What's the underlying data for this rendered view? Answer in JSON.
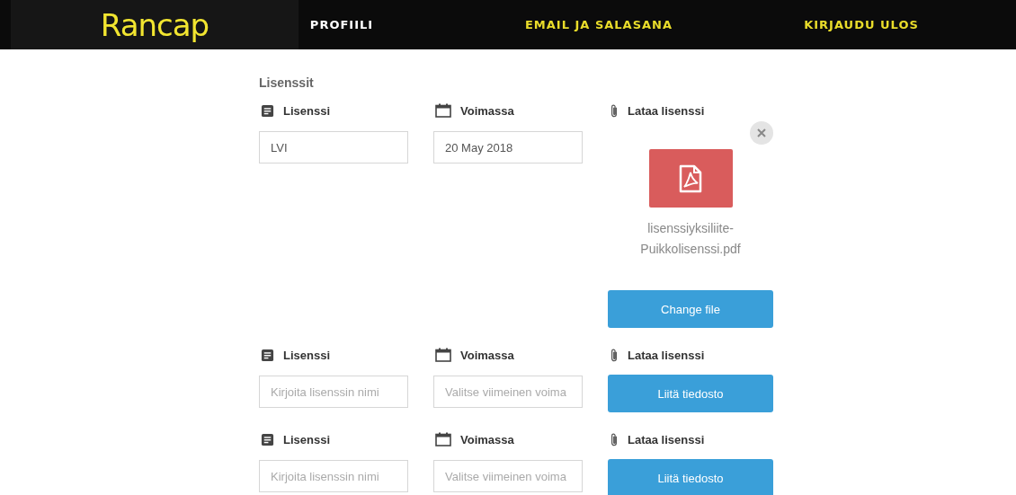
{
  "header": {
    "logo": "Rancap",
    "nav": [
      {
        "label": "PROFIILI",
        "selected": true
      },
      {
        "label": "EMAIL JA SALASANA",
        "selected": false
      },
      {
        "label": "KIRJAUDU ULOS",
        "selected": false
      }
    ]
  },
  "section_title": "Lisenssit",
  "licenses": [
    {
      "kind": "uploaded",
      "name_label": "Lisenssi",
      "name_value": "LVI",
      "date_label": "Voimassa",
      "date_value": "20 May 2018",
      "upload_label": "Lataa lisenssi",
      "file_name": "lisenssiyksiliite-Puikkolisenssi.pdf",
      "button": "Change file"
    },
    {
      "kind": "empty",
      "name_label": "Lisenssi",
      "name_placeholder": "Kirjoita lisenssin nimi",
      "date_label": "Voimassa",
      "date_placeholder": "Valitse viimeinen voima",
      "upload_label": "Lataa lisenssi",
      "button": "Liitä tiedosto"
    },
    {
      "kind": "empty",
      "name_label": "Lisenssi",
      "name_placeholder": "Kirjoita lisenssin nimi",
      "date_label": "Voimassa",
      "date_placeholder": "Valitse viimeinen voima",
      "upload_label": "Lataa lisenssi",
      "button": "Liitä tiedosto"
    }
  ]
}
